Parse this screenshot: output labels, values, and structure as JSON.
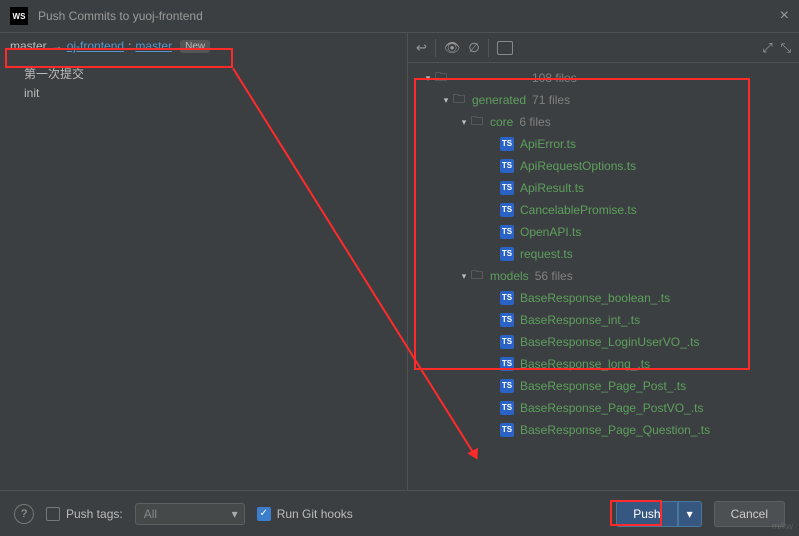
{
  "titlebar": {
    "logo": "WS",
    "title": "Push Commits to yuoj-frontend"
  },
  "branch": {
    "local": "master",
    "arrow": "→",
    "remote_repo": "oj-frontend",
    "sep": ":",
    "remote_branch": "master",
    "new_badge": "New"
  },
  "commits": [
    "第一次提交",
    "init"
  ],
  "tree": {
    "root_count": "108 files",
    "folders": [
      {
        "name": "generated",
        "count": "71 files",
        "indent": 44,
        "expanded": true
      },
      {
        "name": "core",
        "count": "6 files",
        "indent": 62,
        "expanded": true
      }
    ],
    "core_files": [
      "ApiError.ts",
      "ApiRequestOptions.ts",
      "ApiResult.ts",
      "CancelablePromise.ts",
      "OpenAPI.ts",
      "request.ts"
    ],
    "models_folder": {
      "name": "models",
      "count": "56 files",
      "indent": 62,
      "expanded": true
    },
    "model_files": [
      "BaseResponse_boolean_.ts",
      "BaseResponse_int_.ts",
      "BaseResponse_LoginUserVO_.ts",
      "BaseResponse_long_.ts",
      "BaseResponse_Page_Post_.ts",
      "BaseResponse_Page_PostVO_.ts",
      "BaseResponse_Page_Question_.ts"
    ]
  },
  "footer": {
    "help": "?",
    "push_tags_label": "Push tags:",
    "push_tags_value": "All",
    "run_hooks_label": "Run Git hooks",
    "push_btn": "Push",
    "cancel_btn": "Cancel"
  },
  "watermark": "m/kw"
}
